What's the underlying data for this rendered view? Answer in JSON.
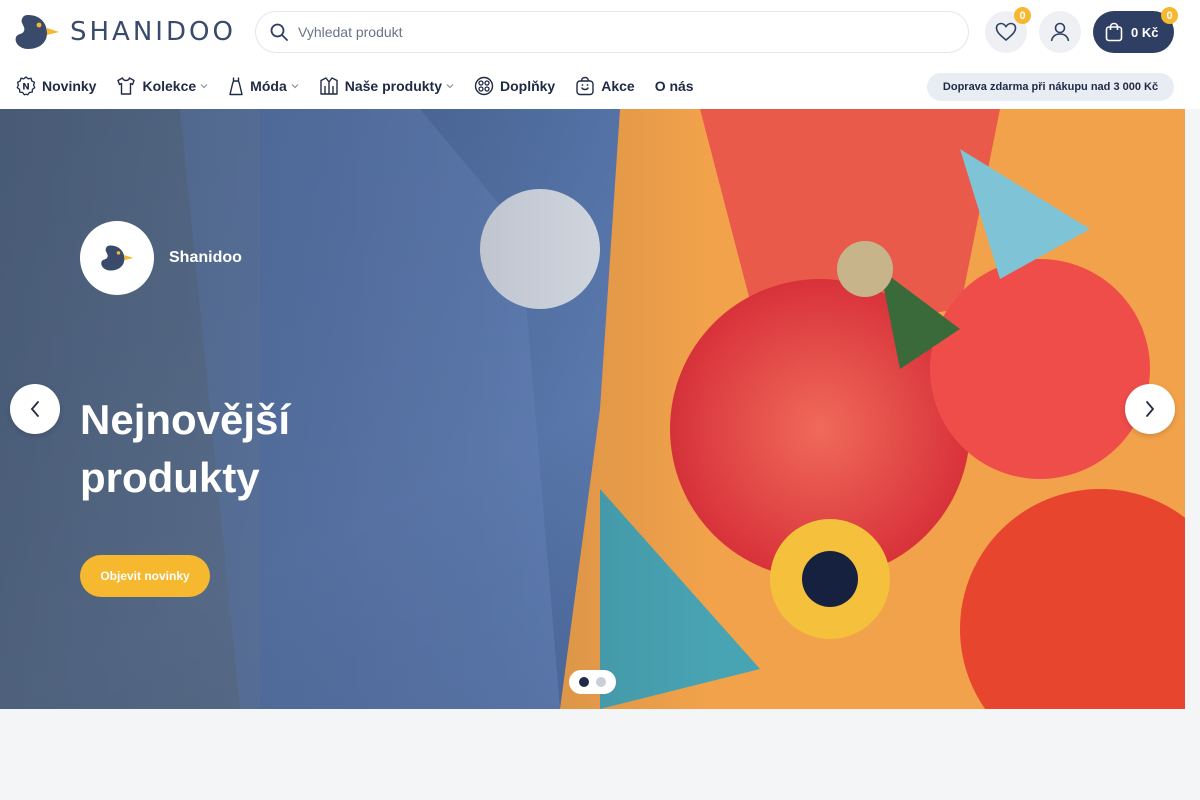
{
  "brand": {
    "logo_text": "SHANIDOO",
    "accent": "#f5b82e",
    "navy": "#2f3f63"
  },
  "search": {
    "placeholder": "Vyhledat produkt"
  },
  "header": {
    "wishlist_count": "0",
    "cart_count": "0",
    "cart_total": "0 Kč"
  },
  "nav": {
    "items": [
      {
        "label": "Novinky",
        "icon": "new-badge-icon"
      },
      {
        "label": "Kolekce",
        "icon": "tshirt-icon",
        "dropdown": true
      },
      {
        "label": "Móda",
        "icon": "dress-icon",
        "dropdown": true
      },
      {
        "label": "Naše produkty",
        "icon": "jacket-icon",
        "dropdown": true
      },
      {
        "label": "Doplňky",
        "icon": "accessories-icon"
      },
      {
        "label": "Akce",
        "icon": "sale-bag-icon"
      },
      {
        "label": "O nás"
      }
    ],
    "shipping_note": "Doprava zdarma při nákupu nad 3 000 Kč"
  },
  "hero": {
    "brand_name": "Shanidoo",
    "title": "Nejnovější produkty",
    "cta": "Objevit novinky",
    "slides_total": 2,
    "slide_active": 1
  }
}
